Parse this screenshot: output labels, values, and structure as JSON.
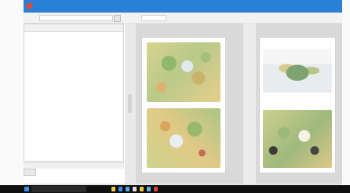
{
  "window": {
    "title": "",
    "menu": [
      "",
      "",
      ""
    ]
  },
  "toolbar": {
    "left_label": "",
    "right_label": ""
  },
  "left_panel": {
    "columns": [
      "",
      "",
      "",
      ""
    ],
    "footer_button": ""
  },
  "pages": [
    {
      "thumbnails": [
        "map-thumbnail",
        "map-thumbnail"
      ]
    },
    {
      "thumbnails": [
        "map-thumbnail",
        "map-thumbnail"
      ]
    }
  ],
  "taskbar": {
    "clock": "",
    "apps": [
      "explorer-icon",
      "browser-icon",
      "mail-icon",
      "store-icon",
      "files-icon",
      "media-icon",
      "pdf-icon"
    ],
    "app_colors": [
      "#f2c744",
      "#3c8fe3",
      "#5aa7e8",
      "#e0e0e0",
      "#f2c744",
      "#5bb0e6",
      "#d9443a"
    ]
  }
}
